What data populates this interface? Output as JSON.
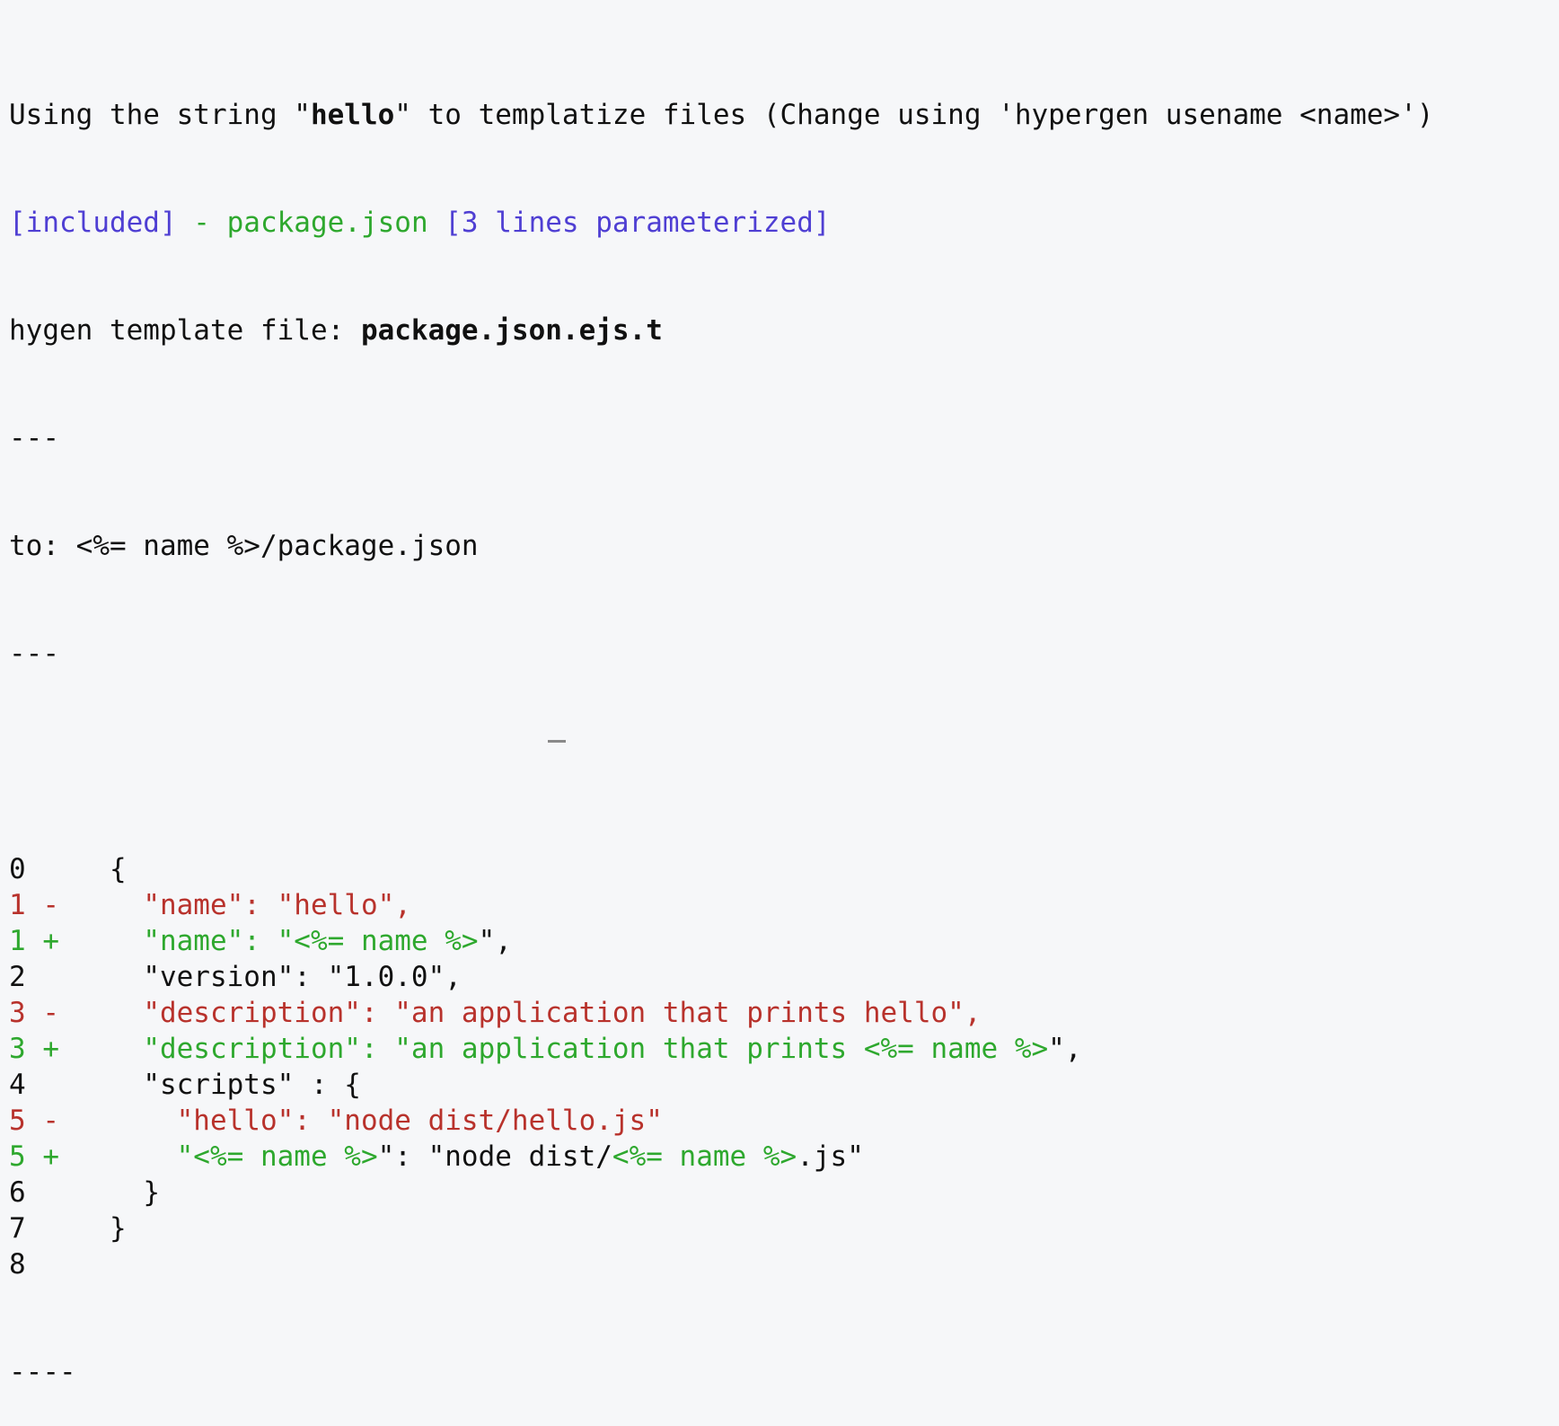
{
  "header": {
    "prefix": "Using the string \"",
    "string": "hello",
    "suffix": "\" to templatize files (Change using 'hypergen usename <name>')"
  },
  "included": {
    "tag": "[included]",
    "dash": " - ",
    "filename": "package.json",
    "count": " [3 lines parameterized]"
  },
  "template": {
    "label": "hygen template file: ",
    "filename": "package.json.ejs.t"
  },
  "frontmatter": {
    "sep_open": "---",
    "to_line": "to: <%= name %>/package.json",
    "sep_close": "---"
  },
  "diff": {
    "lines": [
      {
        "gutter": "0     ",
        "segs": [
          {
            "t": "{",
            "c": "black"
          }
        ]
      },
      {
        "gutter": "1 -     ",
        "gc": "red",
        "segs": [
          {
            "t": "\"name\": \"hello\",",
            "c": "red"
          }
        ]
      },
      {
        "gutter": "1 +     ",
        "gc": "green",
        "segs": [
          {
            "t": "\"name\": \"<%= name %>",
            "c": "green"
          },
          {
            "t": "\",",
            "c": "black"
          }
        ]
      },
      {
        "gutter": "2       ",
        "segs": [
          {
            "t": "\"version\": \"1.0.0\",",
            "c": "black"
          }
        ]
      },
      {
        "gutter": "3 -     ",
        "gc": "red",
        "segs": [
          {
            "t": "\"description\": \"an application that prints hello\",",
            "c": "red"
          }
        ]
      },
      {
        "gutter": "3 +     ",
        "gc": "green",
        "segs": [
          {
            "t": "\"description\": \"an application that prints <%= name %>",
            "c": "green"
          },
          {
            "t": "\",",
            "c": "black"
          }
        ]
      },
      {
        "gutter": "4       ",
        "segs": [
          {
            "t": "\"scripts\" : {",
            "c": "black"
          }
        ]
      },
      {
        "gutter": "5 -       ",
        "gc": "red",
        "segs": [
          {
            "t": "\"hello\": \"node dist/hello.js\"",
            "c": "red"
          }
        ]
      },
      {
        "gutter": "5 +       ",
        "gc": "green",
        "segs": [
          {
            "t": "\"<%= name %>",
            "c": "green"
          },
          {
            "t": "\": \"node dist/",
            "c": "black"
          },
          {
            "t": "<%= name %>",
            "c": "green"
          },
          {
            "t": ".js\"",
            "c": "black"
          }
        ]
      },
      {
        "gutter": "6       ",
        "segs": [
          {
            "t": "}",
            "c": "black"
          }
        ]
      },
      {
        "gutter": "7     ",
        "segs": [
          {
            "t": "}",
            "c": "black"
          }
        ]
      },
      {
        "gutter": "8",
        "segs": []
      }
    ]
  },
  "footer": {
    "separator": "----"
  }
}
